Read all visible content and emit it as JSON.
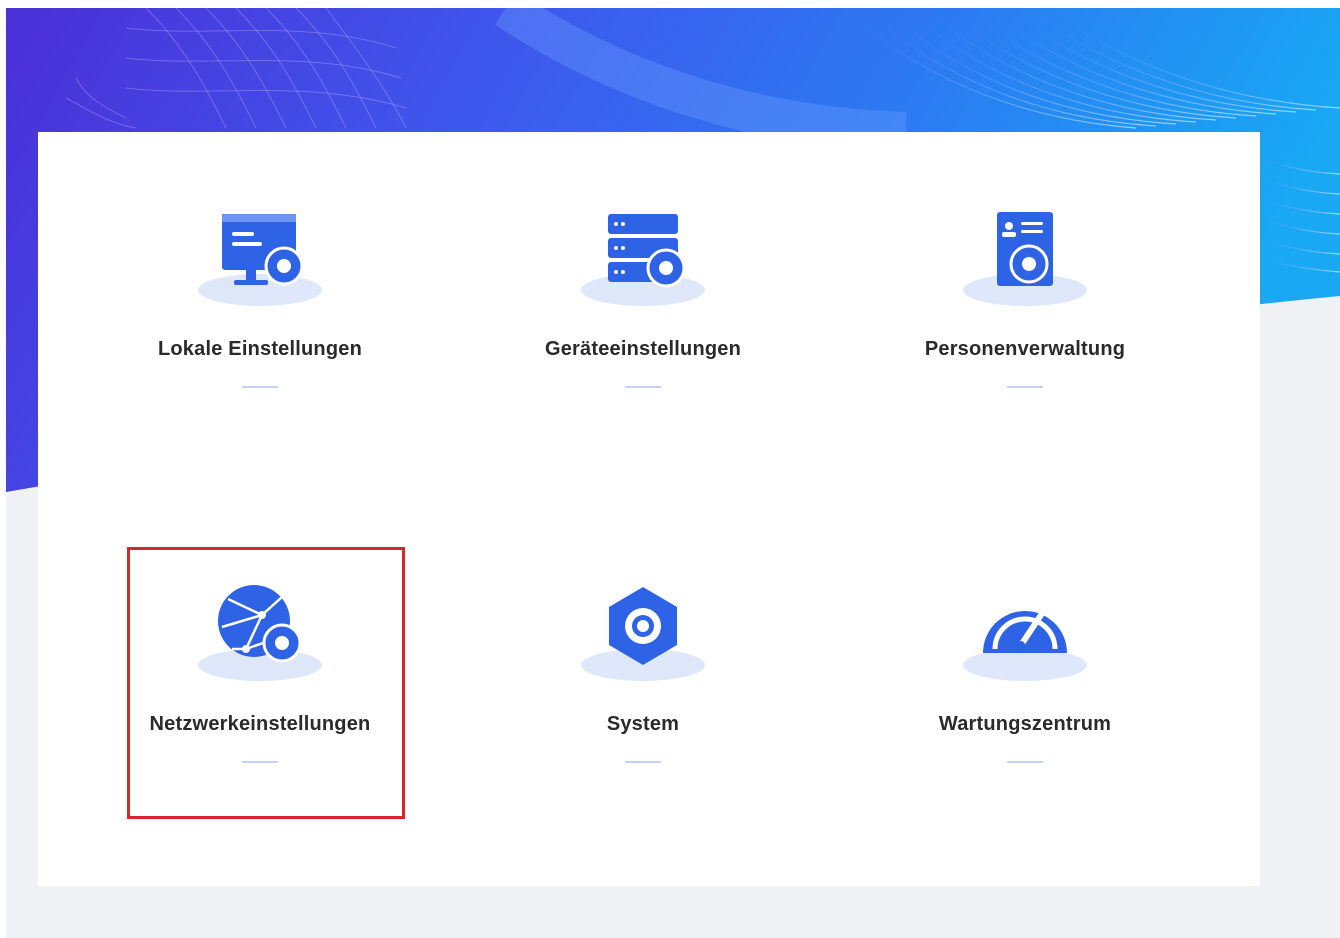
{
  "colors": {
    "accent": "#2f63e6",
    "accent_light": "#dfe8fb",
    "highlight": "#d9262b",
    "label": "#2a2a2a",
    "background": "#f0f1f4"
  },
  "tiles": [
    {
      "label": "Lokale Einstellungen",
      "icon": "monitor-gear-icon"
    },
    {
      "label": "Geräteeinstellungen",
      "icon": "server-gear-icon"
    },
    {
      "label": "Personenverwaltung",
      "icon": "id-card-gear-icon"
    },
    {
      "label": "Netzwerkeinstellungen",
      "icon": "globe-gear-icon",
      "highlighted": true
    },
    {
      "label": "System",
      "icon": "hexagon-gear-icon"
    },
    {
      "label": "Wartungszentrum",
      "icon": "gauge-icon"
    }
  ]
}
